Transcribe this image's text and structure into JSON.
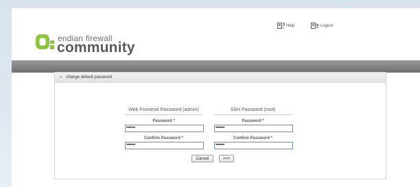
{
  "header": {
    "logo_line1": "endian firewall",
    "logo_line2": "community",
    "links": [
      {
        "label": "Help",
        "icon": "help-icon"
      },
      {
        "label": "Logout",
        "icon": "logout-icon"
      }
    ]
  },
  "panel": {
    "title_arrows": "»",
    "title": "change default password"
  },
  "web": {
    "title": "Web Frontend Password (admin)",
    "password_label": "Password *",
    "password_value": "••••••••",
    "confirm_label": "Confirm Password *",
    "confirm_value": "••••••••"
  },
  "ssh": {
    "title": "SSH Password (root)",
    "password_label": "Password *",
    "password_value": "••••••••",
    "confirm_label": "Confirm Password *",
    "confirm_value": "••••••••"
  },
  "buttons": {
    "cancel": "Cancel",
    "next": ">>>"
  },
  "colors": {
    "logo_green": "#8cc63f",
    "grey_bar": "#7d7d7d"
  }
}
